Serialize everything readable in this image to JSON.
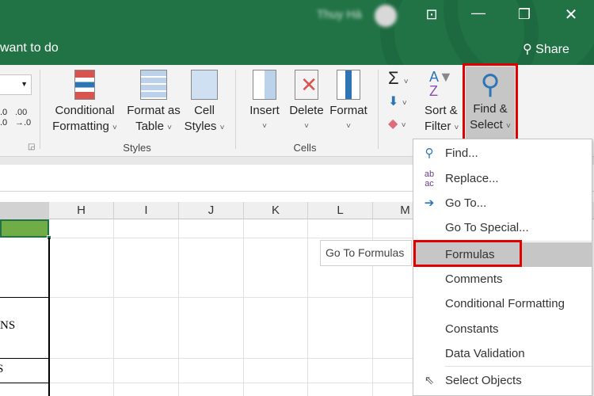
{
  "titlebar": {
    "user_name": "Thuy Hà",
    "tell_me": "want to do",
    "share": "Share",
    "accent": "#217346"
  },
  "ribbon": {
    "number": {
      "inc_decimal": ".0\n.0",
      "dec_decimal": ".00\n→.0"
    },
    "styles": {
      "group": "Styles",
      "items": [
        {
          "line1": "Conditional",
          "line2": "Formatting"
        },
        {
          "line1": "Format as",
          "line2": "Table"
        },
        {
          "line1": "Cell",
          "line2": "Styles"
        }
      ]
    },
    "cells": {
      "group": "Cells",
      "items": [
        "Insert",
        "Delete",
        "Format"
      ]
    },
    "editing": {
      "sort_line1": "Sort &",
      "sort_line2": "Filter",
      "find_line1": "Find &",
      "find_line2": "Select"
    }
  },
  "columns": [
    "H",
    "I",
    "J",
    "K",
    "L",
    "M"
  ],
  "cells": [
    "NS",
    "S"
  ],
  "tooltip": "Go To Formulas",
  "menu": {
    "items": [
      {
        "label": "Find...",
        "icon": "search-icon"
      },
      {
        "label": "Replace...",
        "icon": "replace-icon"
      },
      {
        "label": "Go To...",
        "icon": "arrow-right-icon"
      },
      {
        "label": "Go To Special...",
        "icon": ""
      },
      {
        "label": "Formulas",
        "icon": "",
        "highlighted": true
      },
      {
        "label": "Comments",
        "icon": ""
      },
      {
        "label": "Conditional Formatting",
        "icon": ""
      },
      {
        "label": "Constants",
        "icon": ""
      },
      {
        "label": "Data Validation",
        "icon": ""
      },
      {
        "label": "Select Objects",
        "icon": "cursor-icon"
      }
    ]
  },
  "highlight_color": "#e00000"
}
